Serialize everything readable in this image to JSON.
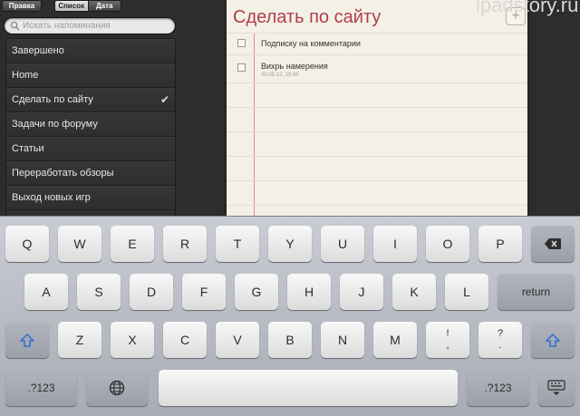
{
  "sidebar": {
    "edit_label": "Правка",
    "segment": [
      "Список",
      "Дата"
    ],
    "search_placeholder": "Искать напоминания",
    "items": [
      {
        "label": "Завершено",
        "checked": false
      },
      {
        "label": "Home",
        "checked": false
      },
      {
        "label": "Сделать по сайту",
        "checked": true
      },
      {
        "label": "Задачи по форуму",
        "checked": false
      },
      {
        "label": "Статьи",
        "checked": false
      },
      {
        "label": "Переработать обзоры",
        "checked": false
      },
      {
        "label": "Выход новых игр",
        "checked": false
      }
    ],
    "check_glyph": "✔"
  },
  "note": {
    "title": "Сделать по сайту",
    "add_glyph": "+",
    "tasks": [
      {
        "text": "Подписку на комментарии",
        "date": ""
      },
      {
        "text": "Вихрь намерения",
        "date": "20.05.12, 10:45"
      }
    ]
  },
  "watermark": "ipadstory.ru",
  "keyboard": {
    "row1": [
      "Q",
      "W",
      "E",
      "R",
      "T",
      "Y",
      "U",
      "I",
      "O",
      "P"
    ],
    "row2": [
      "A",
      "S",
      "D",
      "F",
      "G",
      "H",
      "J",
      "K",
      "L"
    ],
    "row3": [
      "Z",
      "X",
      "C",
      "V",
      "B",
      "N",
      "M"
    ],
    "punct1": [
      "!",
      ","
    ],
    "punct2": [
      "?",
      "."
    ],
    "return_label": "return",
    "numbers_label": ".?123",
    "icons": {
      "backspace": "backspace-icon",
      "shift": "shift-icon",
      "globe": "globe-icon",
      "hide": "hide-keyboard-icon"
    },
    "accent_color": "#2f6fd6"
  }
}
